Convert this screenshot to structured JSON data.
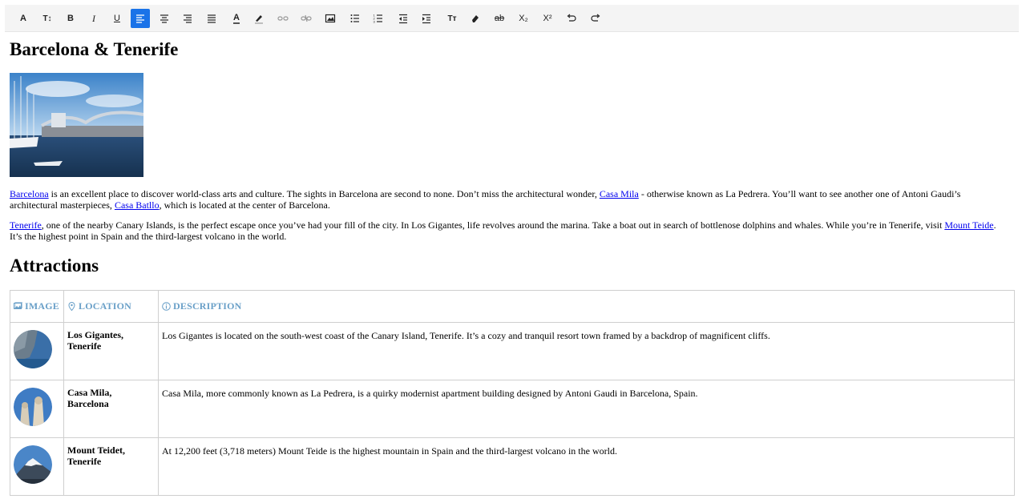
{
  "toolbar": {
    "buttons": [
      {
        "name": "font-family-button",
        "glyph": "A"
      },
      {
        "name": "font-size-button",
        "glyph": "T↕"
      },
      {
        "name": "bold-button",
        "glyph": "B"
      },
      {
        "name": "italic-button",
        "glyph": "I"
      },
      {
        "name": "underline-button",
        "glyph": "U"
      },
      {
        "name": "align-left-button",
        "glyph": "",
        "active": true
      },
      {
        "name": "align-center-button",
        "glyph": ""
      },
      {
        "name": "align-right-button",
        "glyph": ""
      },
      {
        "name": "align-justify-button",
        "glyph": ""
      },
      {
        "name": "font-color-button",
        "glyph": "A"
      },
      {
        "name": "highlight-button",
        "glyph": ""
      },
      {
        "name": "link-button",
        "glyph": ""
      },
      {
        "name": "unlink-button",
        "glyph": ""
      },
      {
        "name": "image-button",
        "glyph": ""
      },
      {
        "name": "bulleted-list-button",
        "glyph": ""
      },
      {
        "name": "numbered-list-button",
        "glyph": ""
      },
      {
        "name": "outdent-button",
        "glyph": ""
      },
      {
        "name": "indent-button",
        "glyph": ""
      },
      {
        "name": "text-format-button",
        "glyph": "Tт"
      },
      {
        "name": "clear-format-button",
        "glyph": ""
      },
      {
        "name": "strikethrough-button",
        "glyph": "ab"
      },
      {
        "name": "subscript-button",
        "glyph": "X₂"
      },
      {
        "name": "superscript-button",
        "glyph": "X²"
      },
      {
        "name": "undo-button",
        "glyph": ""
      },
      {
        "name": "redo-button",
        "glyph": ""
      }
    ]
  },
  "page": {
    "title": "Barcelona & Tenerife",
    "para1": {
      "link1": "Barcelona",
      "text1": " is an excellent place to discover world-class arts and culture. The sights in Barcelona are second to none. Don’t miss the architectural wonder, ",
      "link2": "Casa Mila",
      "text2": " - otherwise known as La Pedrera. You’ll want to see another one of Antoni Gaudi’s architectural masterpieces, ",
      "link3": "Casa Batllo",
      "text3": ", which is located at the center of Barcelona."
    },
    "para2": {
      "link1": "Tenerife",
      "text1": ", one of the nearby Canary Islands, is the perfect escape once you’ve had your fill of the city. In Los Gigantes, life revolves around the marina. Take a boat out in search of bottlenose dolphins and whales. While you’re in Tenerife, visit ",
      "link2": "Mount Teide",
      "text2": ". It’s the highest point in Spain and the third-largest volcano in the world."
    },
    "section_title": "Attractions"
  },
  "table": {
    "headers": [
      "IMAGE",
      "LOCATION",
      "DESCRIPTION"
    ],
    "rows": [
      {
        "location": "Los Gigantes, Tenerife",
        "description": "Los Gigantes is located on the south-west coast of the Canary Island, Tenerife. It’s a cozy and tranquil resort town framed by a backdrop of magnificent cliffs."
      },
      {
        "location": "Casa Mila, Barcelona",
        "description": "Casa Mila, more commonly known as La Pedrera, is a quirky modernist apartment building designed by Antoni Gaudi in Barcelona, Spain."
      },
      {
        "location": "Mount Teidet, Tenerife",
        "description": "At 12,200 feet (3,718 meters) Mount Teide is the highest mountain in Spain and the third-largest volcano in the world."
      }
    ]
  },
  "colors": {
    "accent": "#1a73e8",
    "link": "#0000ee",
    "table_header": "#6aa0c8"
  }
}
